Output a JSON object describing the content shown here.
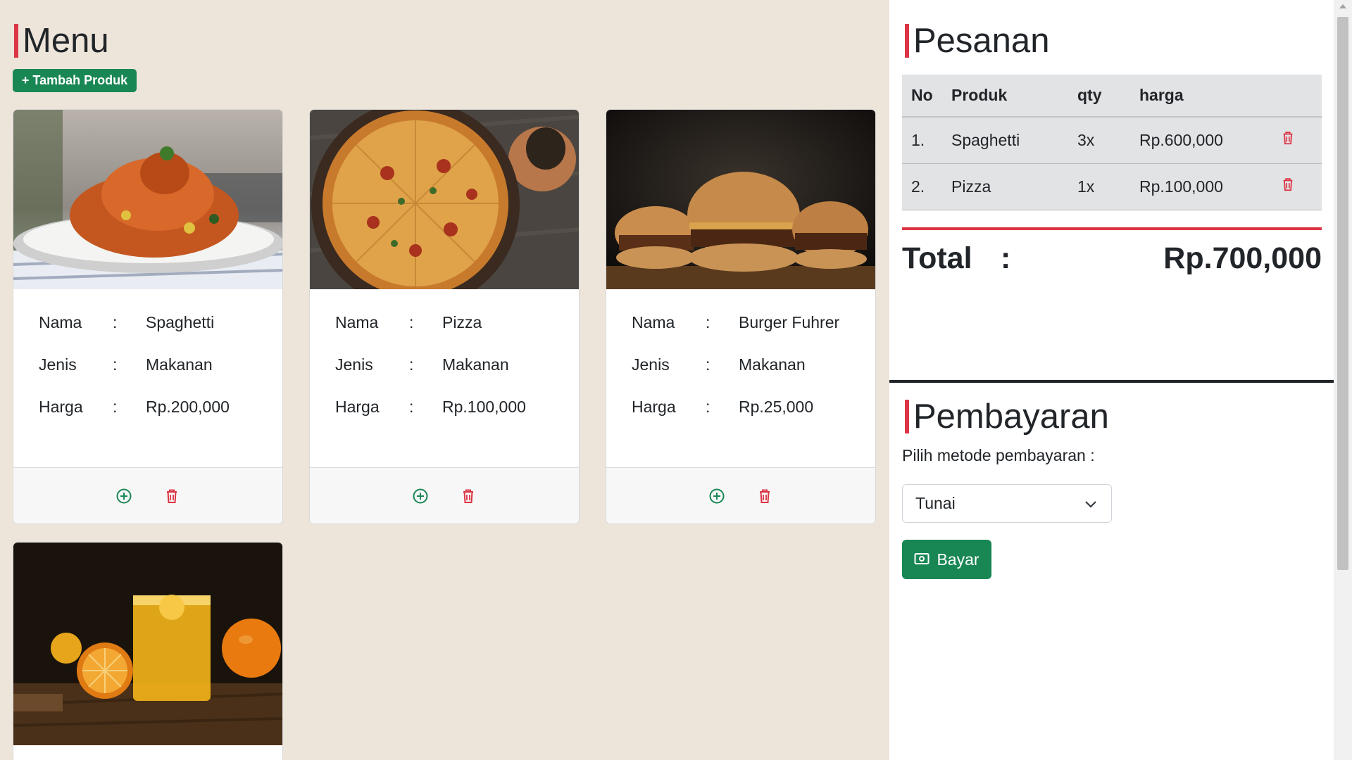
{
  "menu": {
    "title": "Menu",
    "add_button_label": "+ Tambah Produk",
    "products": [
      {
        "name_label": "Nama",
        "name": "Spaghetti",
        "type_label": "Jenis",
        "type": "Makanan",
        "price_label": "Harga",
        "price": "Rp.200,000",
        "separator": ":",
        "image": "spaghetti-photo"
      },
      {
        "name_label": "Nama",
        "name": "Pizza",
        "type_label": "Jenis",
        "type": "Makanan",
        "price_label": "Harga",
        "price": "Rp.100,000",
        "separator": ":",
        "image": "pizza-photo"
      },
      {
        "name_label": "Nama",
        "name": "Burger Fuhrer",
        "type_label": "Jenis",
        "type": "Makanan",
        "price_label": "Harga",
        "price": "Rp.25,000",
        "separator": ":",
        "image": "burger-photo"
      },
      {
        "image": "orange-juice-photo"
      }
    ]
  },
  "order": {
    "title": "Pesanan",
    "columns": [
      "No",
      "Produk",
      "qty",
      "harga"
    ],
    "rows": [
      {
        "no": "1.",
        "product": "Spaghetti",
        "qty": "3x",
        "price": "Rp.600,000"
      },
      {
        "no": "2.",
        "product": "Pizza",
        "qty": "1x",
        "price": "Rp.100,000"
      }
    ],
    "total_label": "Total",
    "total_separator": ":",
    "total_value": "Rp.700,000"
  },
  "payment": {
    "title": "Pembayaran",
    "label": "Pilih metode pembayaran :",
    "selected_method": "Tunai",
    "pay_button_label": "Bayar"
  },
  "colors": {
    "accent_red": "#dc3545",
    "success_green": "#198754",
    "background": "#ede5da",
    "table_bg": "#e2e3e5"
  }
}
